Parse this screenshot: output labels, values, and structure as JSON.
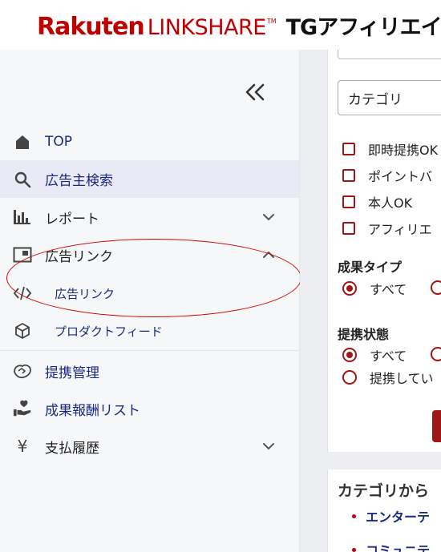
{
  "header": {
    "logo_rakuten": "Rakuten",
    "logo_linkshare": "LINKSHARE",
    "logo_tm": "TM",
    "logo_tg": "TGアフィリエイト"
  },
  "sidebar": {
    "items": [
      {
        "label": "TOP",
        "icon": "home-icon"
      },
      {
        "label": "広告主検索",
        "icon": "search-icon"
      },
      {
        "label": "レポート",
        "icon": "bar-chart-icon"
      },
      {
        "label": "広告リンク",
        "icon": "image-frame-icon"
      },
      {
        "label": "広告リンク",
        "icon": "code-icon"
      },
      {
        "label": "プロダクトフィード",
        "icon": "cube-icon"
      },
      {
        "label": "提携管理",
        "icon": "handshake-icon"
      },
      {
        "label": "成果報酬リスト",
        "icon": "hand-heart-icon"
      },
      {
        "label": "支払履歴",
        "icon": "yen-icon"
      }
    ],
    "yen_glyph": "¥"
  },
  "main": {
    "category_select": "カテゴリ",
    "checkboxes": [
      "即時提携OK",
      "ポイントバ",
      "本人OK",
      "アフィリエ"
    ],
    "result_type": {
      "title": "成果タイプ",
      "options": [
        "すべて"
      ]
    },
    "partner_status": {
      "title": "提携状態",
      "options": [
        "すべて",
        "提携してい"
      ]
    },
    "category_section": {
      "title": "カテゴリから",
      "links": [
        "エンターテ",
        "コミュニテ"
      ]
    }
  },
  "colors": {
    "brand_red": "#bf0000",
    "accent_red": "#a01515",
    "nav_blue": "#1a2a80"
  }
}
